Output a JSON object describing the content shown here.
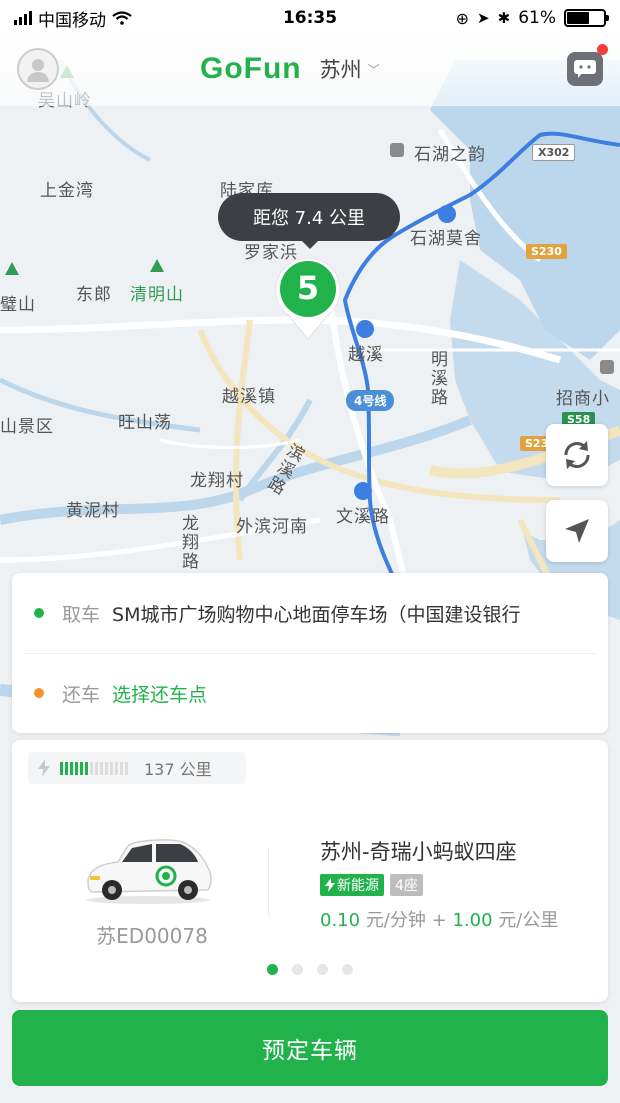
{
  "status_bar": {
    "carrier": "中国移动",
    "time": "16:35",
    "battery": "61%",
    "battery_level": 0.61
  },
  "header": {
    "logo": "GoFun",
    "city": "苏州",
    "city_caret": "﹀"
  },
  "map": {
    "labels": {
      "wushanling": "吴山岭",
      "shangjinwan": "上金湾",
      "lujiaku": "陆家库",
      "shihuzhiyun": "石湖之韵",
      "luojiayuan": "罗家浜",
      "shihumoshe": "石湖莫舍",
      "bishan": "璧山",
      "donglang": "东郎",
      "qingmingshan": "清明山",
      "yuexi": "越溪",
      "mingxilu": "明溪路",
      "yuexizhen": "越溪镇",
      "wangshandang": "旺山荡",
      "jingqu": "山景区",
      "zhaoshang": "招商小",
      "longxiangcun": "龙翔村",
      "binxilu": "滨溪路",
      "huangnicun": "黄泥村",
      "waibinhenan": "外滨河南",
      "wenxilu": "文溪路",
      "longxianglu": "龙翔路"
    },
    "shields": {
      "x302": "X302",
      "s230": "S230",
      "s58": "S58",
      "s23": "S23",
      "line4": "4号线"
    }
  },
  "pin": {
    "distance_text": "距您 7.4 公里",
    "count": "5"
  },
  "location_card": {
    "pickup_label": "取车",
    "pickup_value": "SM城市广场购物中心地面停车场（中国建设银行",
    "return_label": "还车",
    "return_value": "选择还车点"
  },
  "car_card": {
    "range_text": "137 公里",
    "range_fraction": 0.5,
    "plate": "苏ED00078",
    "name": "苏州-奇瑞小蚂蚁四座",
    "badge_energy": "新能源",
    "badge_seats": "4座",
    "price_minute": "0.10",
    "price_minute_unit": "元/分钟",
    "price_plus": "+",
    "price_km": "1.00",
    "price_km_unit": "元/公里",
    "page_count": 4,
    "active_page": 0
  },
  "book_button": {
    "label": "预定车辆"
  },
  "colors": {
    "brand_green": "#22b24c",
    "orange_dot": "#f0932b",
    "badge_red": "#f0413a"
  }
}
